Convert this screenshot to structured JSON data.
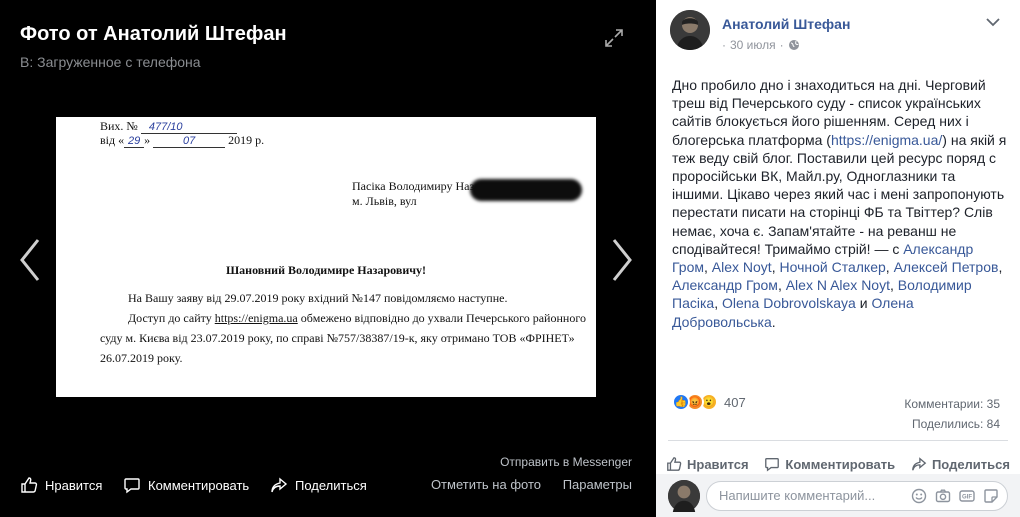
{
  "viewer": {
    "title": "Фото от Анатолий Штефан",
    "subtitle": "В: Загруженное с телефона",
    "send_messenger": "Отправить в Messenger",
    "actions": {
      "like": "Нравится",
      "comment": "Комментировать",
      "share": "Поделиться",
      "tag": "Отметить на фото",
      "options": "Параметры"
    }
  },
  "document": {
    "ref_line": "Вих. №",
    "ref_number": "477/10",
    "date_prefix": "від «",
    "date_day": "29",
    "date_month": "07",
    "date_year": "2019 р.",
    "addressee": "Пасіка Володимиру Назаровичу",
    "address": "м. Львів, вул",
    "greeting": "Шановний Володимире Назаровичу!",
    "line1": "На Вашу заяву від 29.07.2019 року вхідний №147 повідомляємо наступне.",
    "line2_a": "Доступ до сайту ",
    "line2_link": "https://enigma.ua",
    "line2_b": " обмежено відповідно до ухвали Печерського районного",
    "line3": "суду м. Києва від 23.07.2019 року, по справі №757/38387/19-к, яку отримано ТОВ «ФРІНЕТ»",
    "line4": "26.07.2019 року."
  },
  "post": {
    "author": "Анатолий Штефан",
    "date": "30 июля",
    "text_1": "Дно пробило дно і знаходиться на дні. Черговий треш від Печерського суду - список українських сайтів блокується його рішенням. Серед них і блогерська платформа (",
    "link": "https://enigma.ua/",
    "text_2": ") на якій я теж веду свій блог. Поставили цей ресурс поряд с проросійськи ВК, Майл.ру, Одноглазники та іншими. Цікаво через який час і мені запропонують перестати писати на сторінці ФБ та Твіттер? Слів немає, хоча є. Запам'ятайте - на реванш не сподівайтеся! Тримаймо стрій! — с ",
    "tags": [
      "Александр Гром",
      "Alex Noyt",
      "Ночной Сталкер",
      "Алексей Петров",
      "Александр Гром",
      "Alex N Alex Noyt",
      "Володимир Пасіка",
      "Olena Dobrovolskaya"
    ],
    "tag_last": "Олена Добровольська",
    "and": " и ",
    "reactions_count": "407",
    "comments_label": "Комментарии: 35",
    "shares_label": "Поделились: 84",
    "actions": {
      "like": "Нравится",
      "comment": "Комментировать",
      "share": "Поделиться"
    },
    "comment_placeholder": "Напишите комментарий..."
  },
  "colors": {
    "link": "#385898",
    "like_blue": "#2078f4",
    "angry_orange": "#f28a29",
    "wow_yellow": "#f7b125"
  }
}
